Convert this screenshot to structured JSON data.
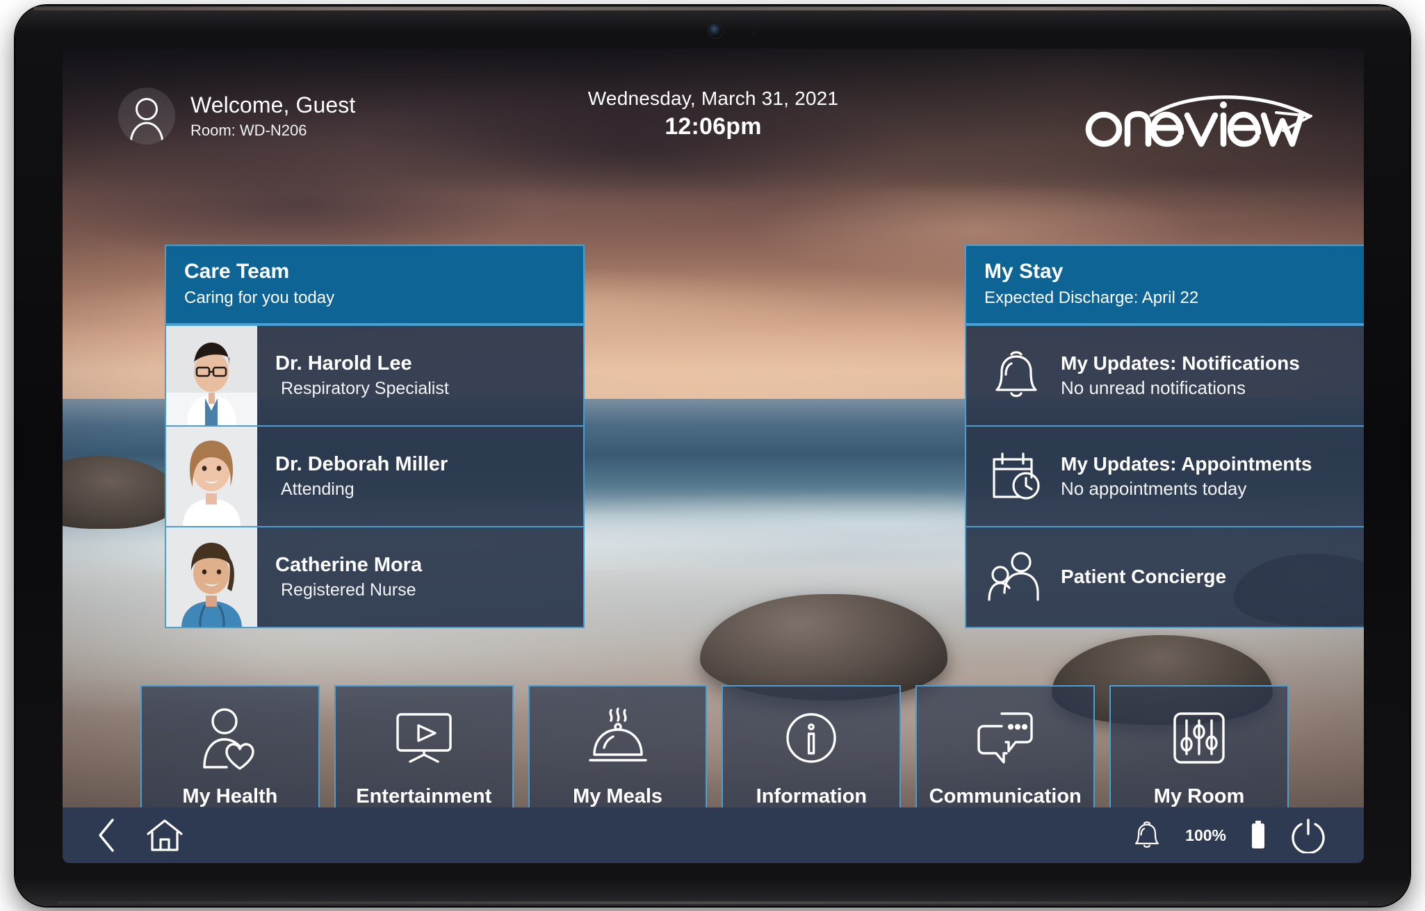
{
  "header": {
    "avatar_icon": "user-avatar-icon",
    "welcome": "Welcome, Guest",
    "room": "Room: WD-N206",
    "date": "Wednesday, March 31, 2021",
    "time": "12:06pm",
    "logo_text": "Oneview"
  },
  "care_team": {
    "title": "Care Team",
    "subtitle": "Caring for you today",
    "members": [
      {
        "name": "Dr. Harold Lee",
        "role": "Respiratory Specialist"
      },
      {
        "name": "Dr. Deborah Miller",
        "role": "Attending"
      },
      {
        "name": "Catherine Mora",
        "role": "Registered Nurse"
      }
    ]
  },
  "my_stay": {
    "title": "My Stay",
    "subtitle": "Expected Discharge: April 22",
    "rows": [
      {
        "icon": "bell-icon",
        "title": "My Updates: Notifications",
        "sub": "No unread notifications"
      },
      {
        "icon": "calendar-clock-icon",
        "title": "My Updates: Appointments",
        "sub": "No appointments today"
      },
      {
        "icon": "two-people-icon",
        "title": "Patient Concierge",
        "sub": ""
      }
    ]
  },
  "tiles": [
    {
      "label": "My Health",
      "icon": "person-heart-icon"
    },
    {
      "label": "Entertainment",
      "icon": "tv-play-icon"
    },
    {
      "label": "My Meals",
      "icon": "food-cloche-icon"
    },
    {
      "label": "Information",
      "icon": "info-circle-icon"
    },
    {
      "label": "Communication",
      "icon": "chat-bubbles-icon"
    },
    {
      "label": "My Room",
      "icon": "sliders-icon"
    }
  ],
  "bottom_bar": {
    "back_icon": "back-chevron-icon",
    "home_icon": "home-icon",
    "bell_icon": "bell-icon",
    "battery_percent": "100%",
    "battery_icon": "battery-full-icon",
    "power_icon": "power-icon"
  },
  "colors": {
    "accent_blue": "#0e6595",
    "border_blue": "#4a9ed0",
    "panel_bg": "#2c384e",
    "bottom_bar": "#2e3a51",
    "text": "#ffffff"
  }
}
